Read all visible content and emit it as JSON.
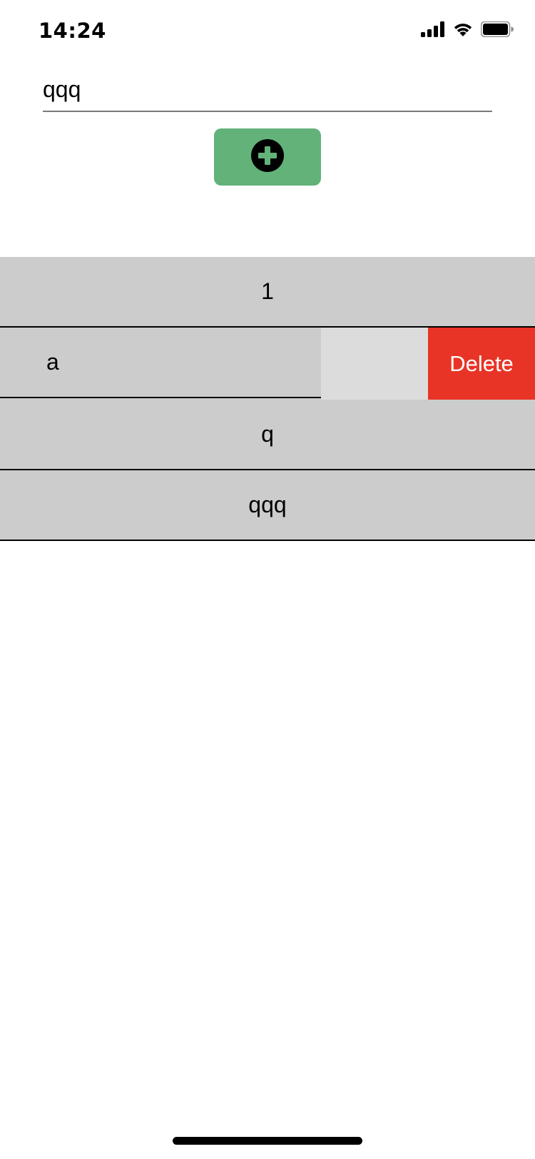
{
  "status_bar": {
    "time": "14:24",
    "icons": [
      "cellular-signal-icon",
      "wifi-icon",
      "battery-icon"
    ]
  },
  "input": {
    "value": "qqq",
    "placeholder": ""
  },
  "add_button": {
    "icon": "plus-circle-icon",
    "color": "#62b27a"
  },
  "list": {
    "items": [
      {
        "label": "1"
      },
      {
        "label": "a",
        "swiped": true,
        "action_label": "Delete",
        "action_color": "#e83426"
      },
      {
        "label": "q"
      },
      {
        "label": "qqq"
      }
    ]
  }
}
